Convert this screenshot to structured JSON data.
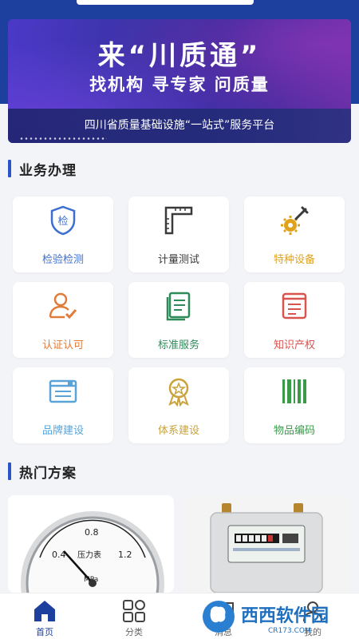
{
  "banner": {
    "title": "来“川质通”",
    "subtitle": "找机构 寻专家 问质量",
    "platform": "四川省质量基础设施“一站式”服务平台"
  },
  "business": {
    "title": "业务办理",
    "items": [
      {
        "label": "检验检测",
        "color": "#3d6fd1",
        "icon": "shield-check-icon"
      },
      {
        "label": "计量测试",
        "color": "#3a3a3a",
        "icon": "ruler-square-icon"
      },
      {
        "label": "特种设备",
        "color": "#e0a21b",
        "icon": "gear-wrench-icon"
      },
      {
        "label": "认证认可",
        "color": "#e07b39",
        "icon": "user-check-icon"
      },
      {
        "label": "标准服务",
        "color": "#2f8a5a",
        "icon": "document-icon"
      },
      {
        "label": "知识产权",
        "color": "#d9534f",
        "icon": "book-icon"
      },
      {
        "label": "品牌建设",
        "color": "#5aa3d6",
        "icon": "brand-book-icon"
      },
      {
        "label": "体系建设",
        "color": "#c9a23a",
        "icon": "award-medal-icon"
      },
      {
        "label": "物品编码",
        "color": "#3a9a4a",
        "icon": "barcode-icon"
      }
    ]
  },
  "hot": {
    "title": "热门方案",
    "products": [
      {
        "icon": "pressure-gauge-image"
      },
      {
        "icon": "gas-meter-image"
      }
    ]
  },
  "gauge": {
    "ticks": [
      "0.4",
      "0.8",
      "1.2"
    ],
    "face_text": "压力表",
    "unit": "MPa"
  },
  "tabbar": {
    "tabs": [
      {
        "label": "首页",
        "icon": "home-icon",
        "active": true
      },
      {
        "label": "分类",
        "icon": "grid-icon",
        "active": false
      },
      {
        "label": "消息",
        "icon": "message-icon",
        "active": false
      },
      {
        "label": "我的",
        "icon": "user-icon",
        "active": false
      }
    ]
  },
  "watermark": {
    "text": "西西软件园",
    "url": "CR173.COM"
  },
  "colors": {
    "brand": "#1d3f9e",
    "accent_bar": "#2a55c9",
    "page_bg": "#f3f4f8"
  }
}
